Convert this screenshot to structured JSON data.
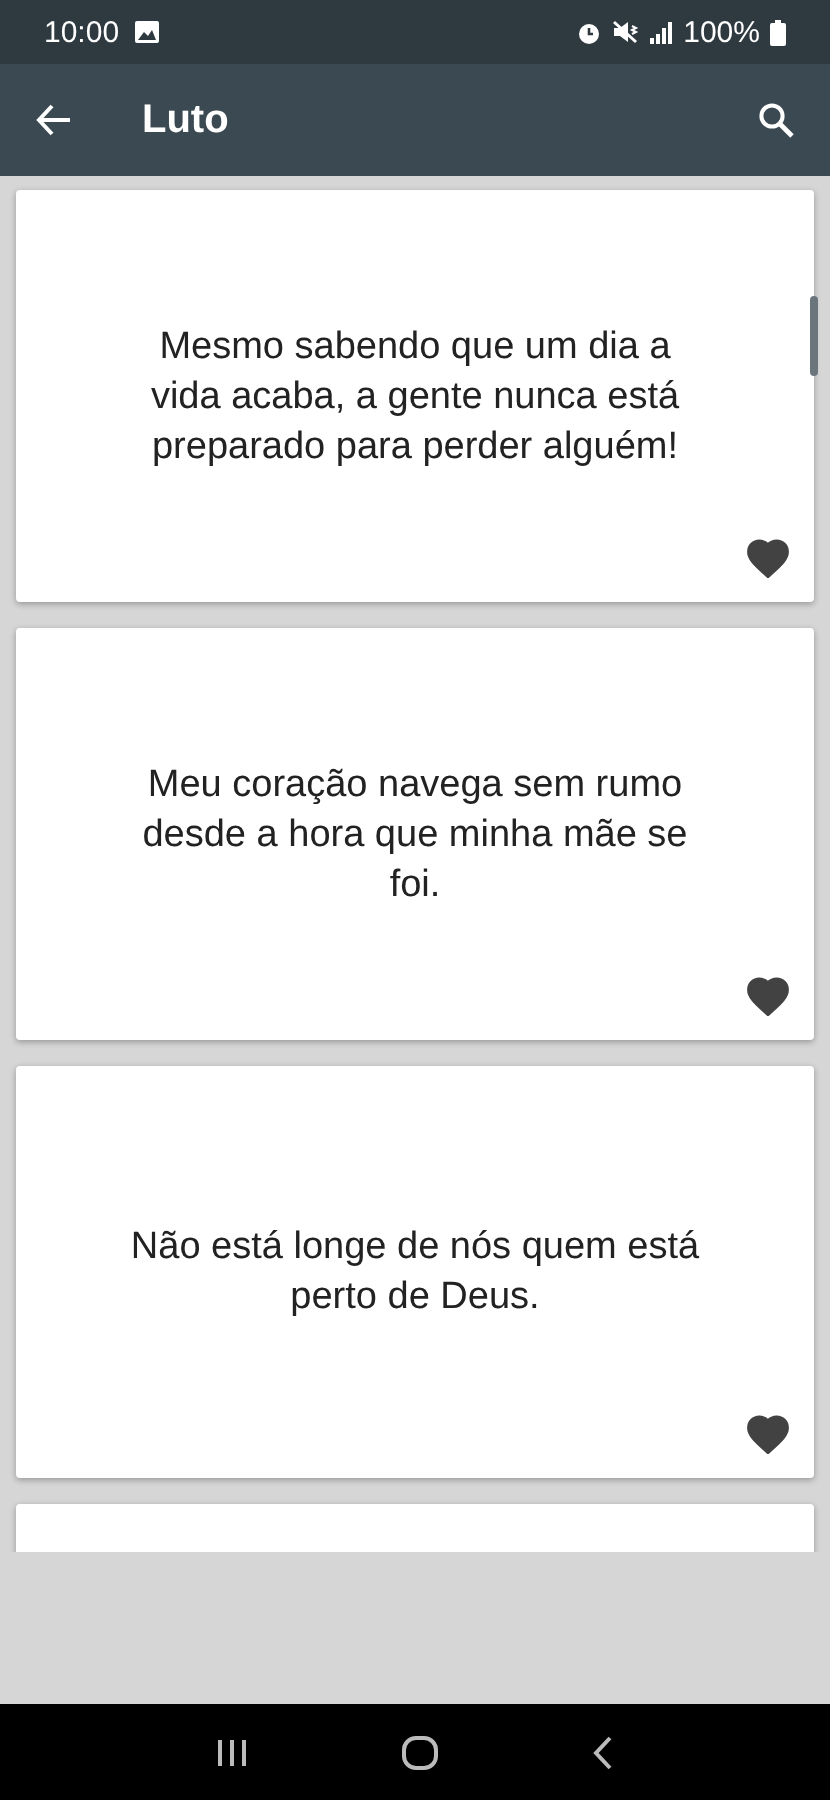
{
  "status_bar": {
    "time": "10:00",
    "battery": "100%"
  },
  "toolbar": {
    "title": "Luto"
  },
  "quotes": [
    {
      "text": "Mesmo sabendo que um dia a vida acaba, a gente nunca está preparado para perder alguém!",
      "favorite": true
    },
    {
      "text": "Meu coração navega sem rumo desde a hora que minha mãe se foi.",
      "favorite": true
    },
    {
      "text": "Não está longe de nós quem está perto de Deus.",
      "favorite": true
    }
  ]
}
